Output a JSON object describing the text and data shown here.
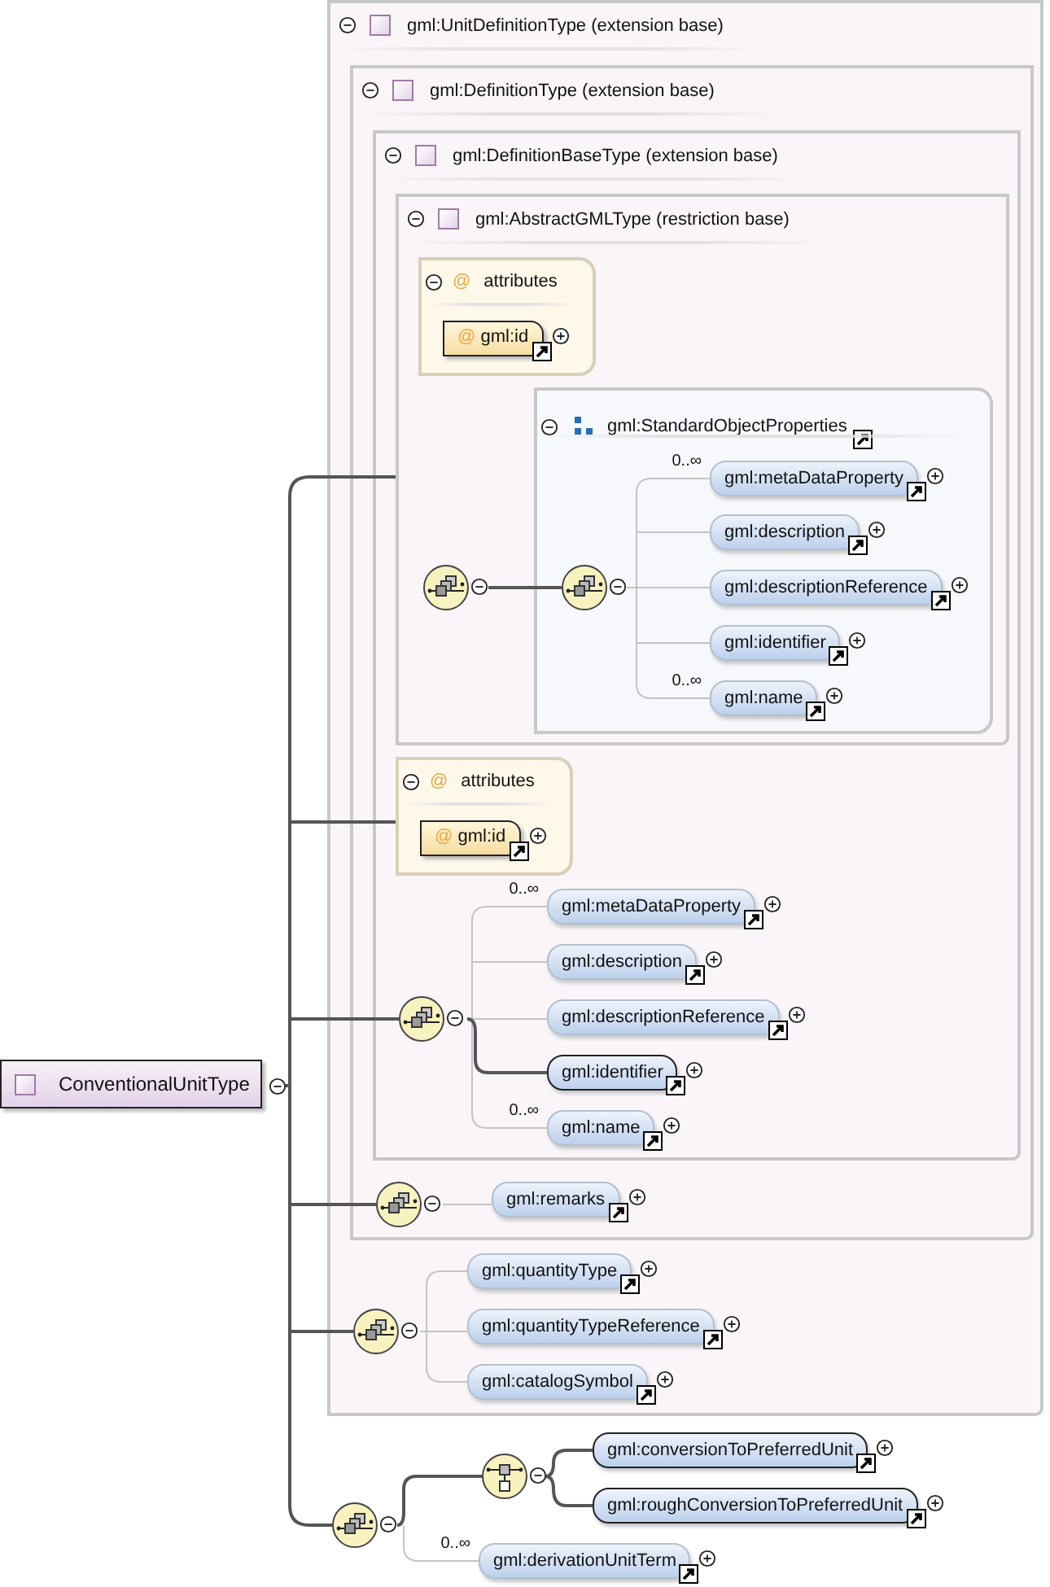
{
  "root": {
    "label": "ConventionalUnitType"
  },
  "type_frames": [
    {
      "label": "gml:UnitDefinitionType (extension base)"
    },
    {
      "label": "gml:DefinitionType (extension base)"
    },
    {
      "label": "gml:DefinitionBaseType (extension base)"
    },
    {
      "label": "gml:AbstractGMLType (restriction base)"
    }
  ],
  "attribute_groups": [
    {
      "icon": "@",
      "title": "attributes",
      "items": [
        {
          "icon": "@",
          "label": "gml:id"
        }
      ]
    },
    {
      "icon": "@",
      "title": "attributes",
      "items": [
        {
          "icon": "@",
          "label": "gml:id"
        }
      ]
    }
  ],
  "group_ref": {
    "label": "gml:StandardObjectProperties"
  },
  "compositors": [
    {
      "kind": "sequence"
    },
    {
      "kind": "sequence"
    },
    {
      "kind": "sequence"
    },
    {
      "kind": "sequence"
    },
    {
      "kind": "sequence"
    },
    {
      "kind": "choice"
    },
    {
      "kind": "sequence"
    }
  ],
  "elements": [
    {
      "label": "gml:metaDataProperty",
      "occurs": "0..∞",
      "required": false
    },
    {
      "label": "gml:description",
      "required": false
    },
    {
      "label": "gml:descriptionReference",
      "required": false
    },
    {
      "label": "gml:identifier",
      "required": false
    },
    {
      "label": "gml:name",
      "occurs": "0..∞",
      "required": false
    },
    {
      "label": "gml:metaDataProperty",
      "occurs": "0..∞",
      "required": false
    },
    {
      "label": "gml:description",
      "required": false
    },
    {
      "label": "gml:descriptionReference",
      "required": false
    },
    {
      "label": "gml:identifier",
      "required": true
    },
    {
      "label": "gml:name",
      "occurs": "0..∞",
      "required": false
    },
    {
      "label": "gml:remarks",
      "required": false
    },
    {
      "label": "gml:quantityType",
      "required": false
    },
    {
      "label": "gml:quantityTypeReference",
      "required": false
    },
    {
      "label": "gml:catalogSymbol",
      "required": false
    },
    {
      "label": "gml:conversionToPreferredUnit",
      "required": true
    },
    {
      "label": "gml:roughConversionToPreferredUnit",
      "required": true
    },
    {
      "label": "gml:derivationUnitTerm",
      "occurs": "0..∞",
      "required": false
    }
  ]
}
